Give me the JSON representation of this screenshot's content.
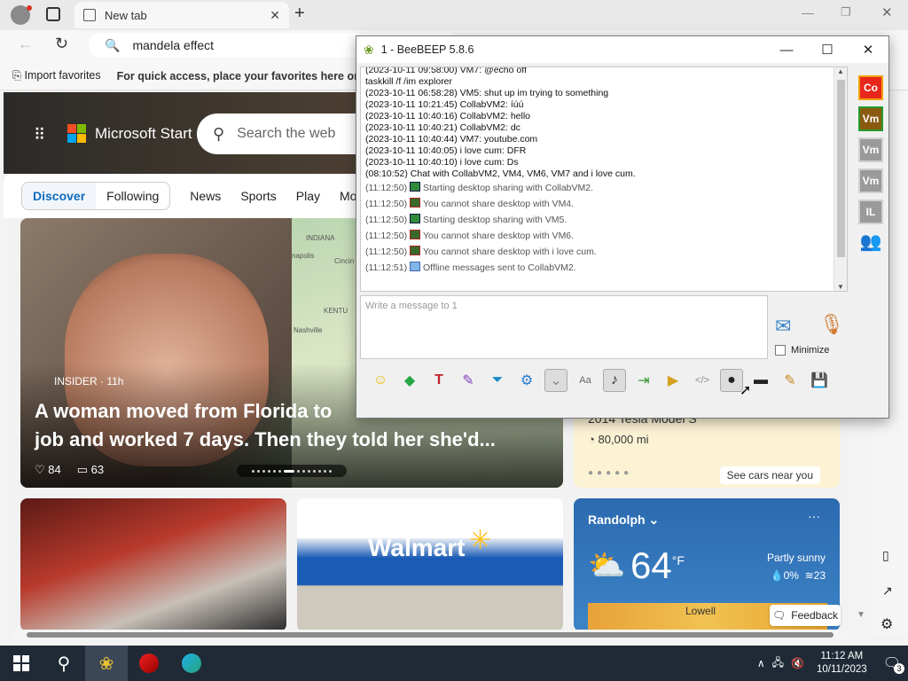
{
  "browser": {
    "tab_title": "New tab",
    "address": "mandela effect",
    "favorites": {
      "import": "Import favorites",
      "hint": "For quick access, place your favorites here on th"
    }
  },
  "msn": {
    "brand": "Microsoft Start",
    "search_placeholder": "Search the web",
    "nav": {
      "discover": "Discover",
      "following": "Following",
      "items": [
        "News",
        "Sports",
        "Play",
        "Mo"
      ]
    },
    "hero_card": {
      "source": "INSIDER · 11h",
      "headline": "A woman moved from Florida to ... job and worked 7 days. Then they told her she'd...",
      "headline_line1": "A woman moved from Florida to",
      "headline_line2": "job and worked 7 days. Then they told her she'd...",
      "likes": "84",
      "comments": "63",
      "map_labels": [
        "INDIANA",
        "napolis",
        "Cincin",
        "KENTU",
        "Nashville"
      ]
    },
    "car_card": {
      "title": "2014 Tesla Model S",
      "mileage": "80,000 mi",
      "cta": "See cars near you"
    },
    "walmart_card": {
      "logo_text": "Walmart"
    },
    "weather": {
      "location": "Randolph",
      "temp": "64",
      "unit": "°F",
      "condition": "Partly sunny",
      "precip": "0%",
      "wind": "23",
      "map_label": "Lowell"
    },
    "feedback": "Feedback"
  },
  "beebeep": {
    "title": "1 - BeeBEEP 5.8.6",
    "chat_lines": [
      "(2023-10-11 09:58:00) VM7: @echo off",
      "taskkill /f /im explorer",
      "(2023-10-11 06:58:28) VM5: shut up im trying to something",
      "(2023-10-11 10:21:45) CollabVM2: íúú",
      "(2023-10-11 10:40:16) CollabVM2: hello",
      "(2023-10-11 10:40:21) CollabVM2: dc",
      "(2023-10-11 10:40:44) VM7: youtube.com",
      "(2023-10-11 10:40:05) i love cum: DFR",
      "(2023-10-11 10:40:10) i love cum: Ds",
      "(08:10:52) Chat with CollabVM2, VM4, VM6, VM7 and i love cum."
    ],
    "system_lines": [
      {
        "time": "(11:12:50)",
        "text": "Starting desktop sharing with CollabVM2.",
        "icon": "green-screen-icon"
      },
      {
        "time": "(11:12:50)",
        "text": "You cannot share desktop with VM4.",
        "icon": "red-screen-icon"
      },
      {
        "time": "(11:12:50)",
        "text": "Starting desktop sharing with VM5.",
        "icon": "green-screen-icon"
      },
      {
        "time": "(11:12:50)",
        "text": "You cannot share desktop with VM6.",
        "icon": "red-screen-icon"
      },
      {
        "time": "(11:12:50)",
        "text": "You cannot share desktop with i love cum.",
        "icon": "red-screen-icon"
      },
      {
        "time": "(11:12:51)",
        "text": "Offline messages sent to CollabVM2.",
        "icon": "envelope-icon"
      }
    ],
    "input_placeholder": "Write a message to 1",
    "minimize_label": "Minimize",
    "users": [
      {
        "label": "Co",
        "color": "#e8261c"
      },
      {
        "label": "Vm",
        "color": "#8a5a10"
      },
      {
        "label": "Vm",
        "color": "#9a9a9a"
      },
      {
        "label": "Vm",
        "color": "#9a9a9a"
      },
      {
        "label": "IL",
        "color": "#9a9a9a"
      }
    ]
  },
  "taskbar": {
    "time": "11:12 AM",
    "date": "10/11/2023",
    "notifications": "3"
  }
}
